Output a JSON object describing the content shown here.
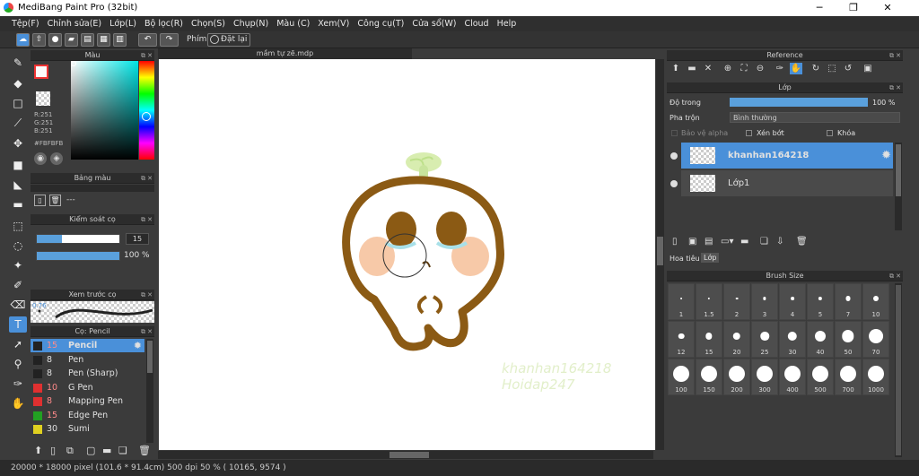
{
  "window": {
    "title": "MediBang Paint Pro (32bit)",
    "minimize": "─",
    "maximize": "❐",
    "close": "✕"
  },
  "menu": [
    "Tệp(F)",
    "Chỉnh sửa(E)",
    "Lớp(L)",
    "Bộ lọc(R)",
    "Chọn(S)",
    "Chụp(N)",
    "Màu (C)",
    "Xem(V)",
    "Công cụ(T)",
    "Cửa sổ(W)",
    "Cloud",
    "Help"
  ],
  "toolbar": {
    "shortcut_label": "Phím",
    "reset_label": "Đặt lại"
  },
  "color_panel": {
    "title": "Màu",
    "r": "R:251",
    "g": "G:251",
    "b": "B:251",
    "hex": "#FBFBFB",
    "fg_color": "#fbfbfb"
  },
  "palette_panel": {
    "title": "Bảng màu",
    "empty": "---"
  },
  "brush_control": {
    "title": "Kiểm soát cọ",
    "size": "15",
    "opacity": "100 %",
    "size_fill": 0.3,
    "opacity_fill": 1.0
  },
  "preview": {
    "title": "Xem trước cọ",
    "scale": "0.76"
  },
  "brush_list": {
    "title": "Cọ: Pencil",
    "items": [
      {
        "size": "15",
        "name": "Pencil",
        "color": "#222222",
        "selected": true
      },
      {
        "size": "8",
        "name": "Pen",
        "color": "#222222"
      },
      {
        "size": "8",
        "name": "Pen (Sharp)",
        "color": "#222222"
      },
      {
        "size": "10",
        "name": "G Pen",
        "color": "#e03030"
      },
      {
        "size": "8",
        "name": "Mapping Pen",
        "color": "#e03030"
      },
      {
        "size": "15",
        "name": "Edge Pen",
        "color": "#22a022"
      },
      {
        "size": "30",
        "name": "Sumi",
        "color": "#e0d020"
      }
    ]
  },
  "document": {
    "tab": "mầm tự zẽ.mdp"
  },
  "reference": {
    "title": "Reference"
  },
  "layer_panel": {
    "title": "Lớp",
    "opacity_label": "Độ trong",
    "opacity_value": "100 %",
    "blend_label": "Pha trộn",
    "blend_value": "Bình thường",
    "protect_alpha": "Bảo vệ alpha",
    "clipping": "Xén bớt",
    "lock": "Khóa",
    "layers": [
      {
        "name": "khanhan164218",
        "selected": true
      },
      {
        "name": "Lớp1",
        "selected": false
      }
    ],
    "tab_navigator": "Hoa tiêu",
    "tab_layer": "Lớp"
  },
  "brush_size": {
    "title": "Brush Size",
    "sizes": [
      "1",
      "1.5",
      "2",
      "3",
      "4",
      "5",
      "7",
      "10",
      "12",
      "15",
      "20",
      "25",
      "30",
      "40",
      "50",
      "70",
      "100",
      "150",
      "200",
      "300",
      "400",
      "500",
      "700",
      "1000"
    ]
  },
  "status": {
    "text": "20000 * 18000 pixel  (101.6 * 91.4cm)  500 dpi  50 %  ( 10165, 9574 )"
  },
  "watermark": {
    "line1": "khanhan164218",
    "line2": "Hoidap247"
  }
}
